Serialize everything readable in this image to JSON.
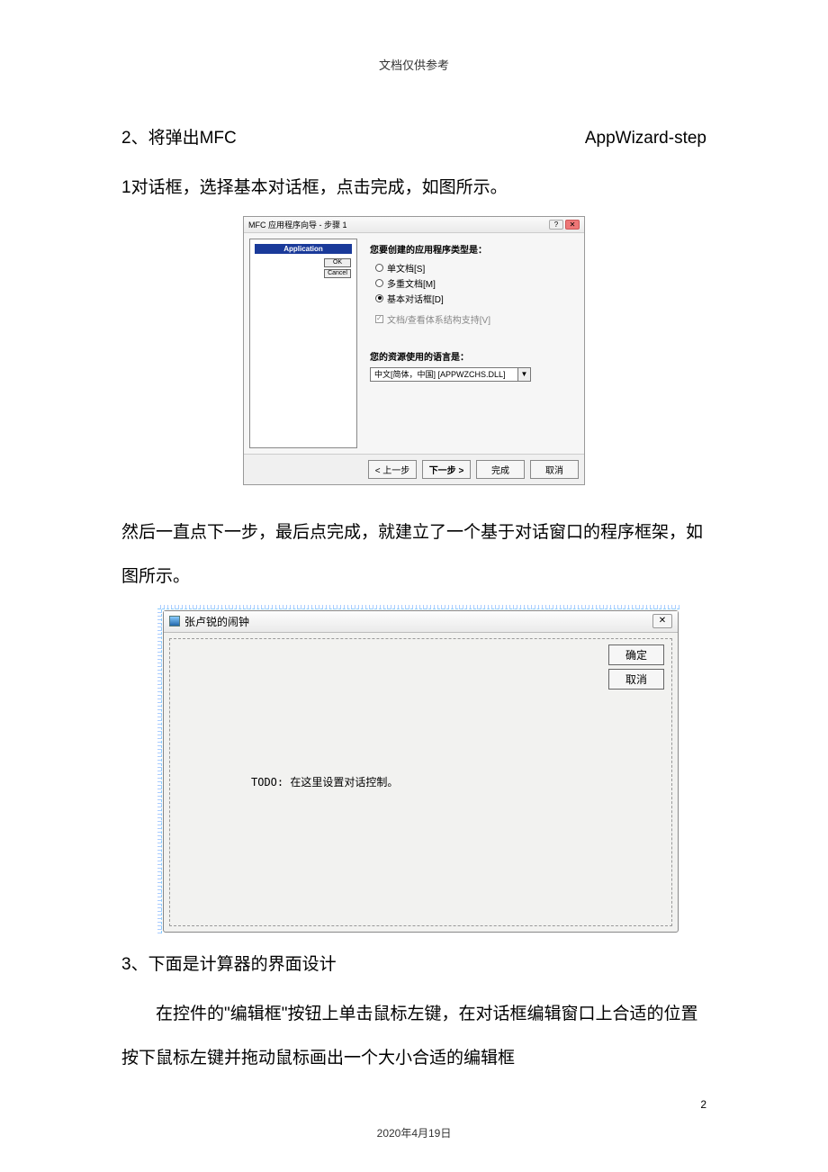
{
  "header_note": "文档仅供参考",
  "para1_left": "2、将弹出MFC",
  "para1_right": "AppWizard-step",
  "para2": "1对话框，选择基本对话框，点击完成，如图所示。",
  "wizard": {
    "title": "MFC 应用程序向导 - 步骤 1",
    "app_banner": "Application",
    "ok": "OK",
    "cancel": "Cancel",
    "q_type": "您要创建的应用程序类型是：",
    "radio1": "单文档[S]",
    "radio2": "多重文档[M]",
    "radio3": "基本对话框[D]",
    "chk": "文档/查看体系结构支持[V]",
    "q_lang": "您的资源使用的语言是：",
    "lang_value": "中文[简体，中国] [APPWZCHS.DLL]",
    "btn_prev": "< 上一步",
    "btn_next": "下一步 >",
    "btn_finish": "完成",
    "btn_cancel": "取消"
  },
  "para3": "然后一直点下一步，最后点完成，就建立了一个基于对话窗口的程序框架，如图所示。",
  "dialog": {
    "title": "张卢锐的闹钟",
    "close_glyph": "✕",
    "ok": "确定",
    "cancel": "取消",
    "todo": "TODO: 在这里设置对话控制。"
  },
  "para4": "3、下面是计算器的界面设计",
  "para5": "在控件的\"编辑框\"按钮上单击鼠标左键，在对话框编辑窗口上合适的位置按下鼠标左键并拖动鼠标画出一个大小合适的编辑框",
  "footer_date": "2020年4月19日",
  "page_num": "2"
}
